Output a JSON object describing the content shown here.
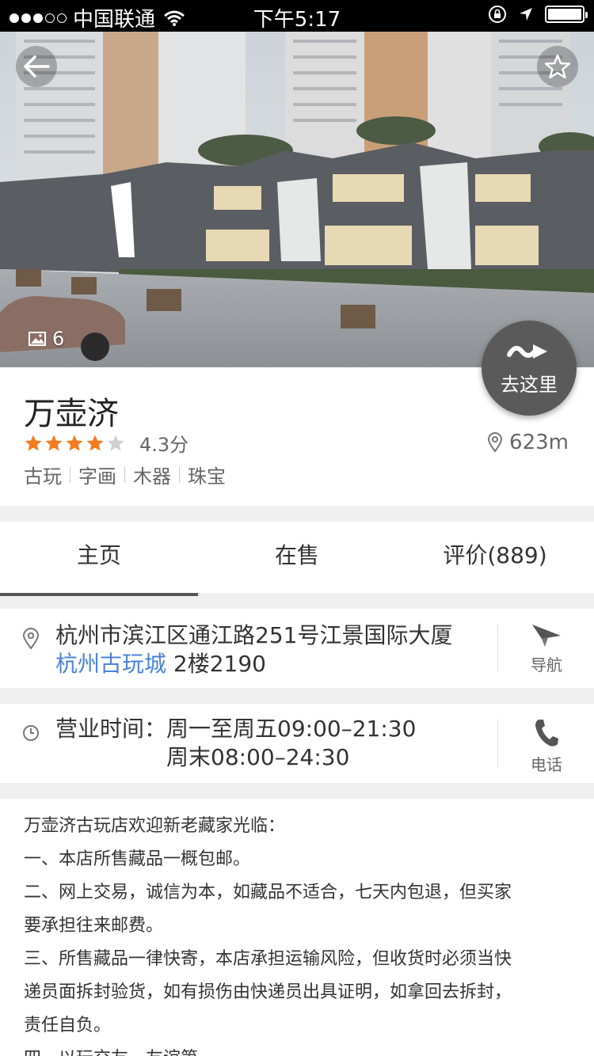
{
  "status_bar": {
    "carrier": "中国联通",
    "time": "下午5:17"
  },
  "hero": {
    "photo_count": "6",
    "goto_label": "去这里"
  },
  "shop": {
    "name": "万壶济",
    "rating_stars": 4,
    "rating_max": 5,
    "score": "4.3分",
    "distance": "623m",
    "tags": [
      "古玩",
      "字画",
      "木器",
      "珠宝"
    ],
    "star_color": "#f47b1f"
  },
  "tabs": [
    {
      "label": "主页",
      "active": true
    },
    {
      "label": "在售",
      "active": false
    },
    {
      "label": "评价(889)",
      "active": false
    }
  ],
  "address": {
    "line1": "杭州市滨江区通江路251号江景国际大厦",
    "link": "杭州古玩城",
    "line2_rest": " 2楼2190",
    "action_label": "导航"
  },
  "hours": {
    "label": "营业时间：",
    "weekday": "周一至周五09:00–21:30",
    "weekend": "周末08:00–24:30",
    "action_label": "电话"
  },
  "description": [
    "万壶济古玩店欢迎新老藏家光临：",
    "一、本店所售藏品一概包邮。",
    "二、网上交易，诚信为本，如藏品不适合，七天内包退，但买家",
    "要承担往来邮费。",
    "三、所售藏品一律快寄，本店承担运输风险，但收货时必须当快",
    "递员面拆封验货，如有损伤由快递员出具证明，如拿回去拆封，",
    "责任自负。",
    "四、以玩交友，友谊第一。"
  ]
}
